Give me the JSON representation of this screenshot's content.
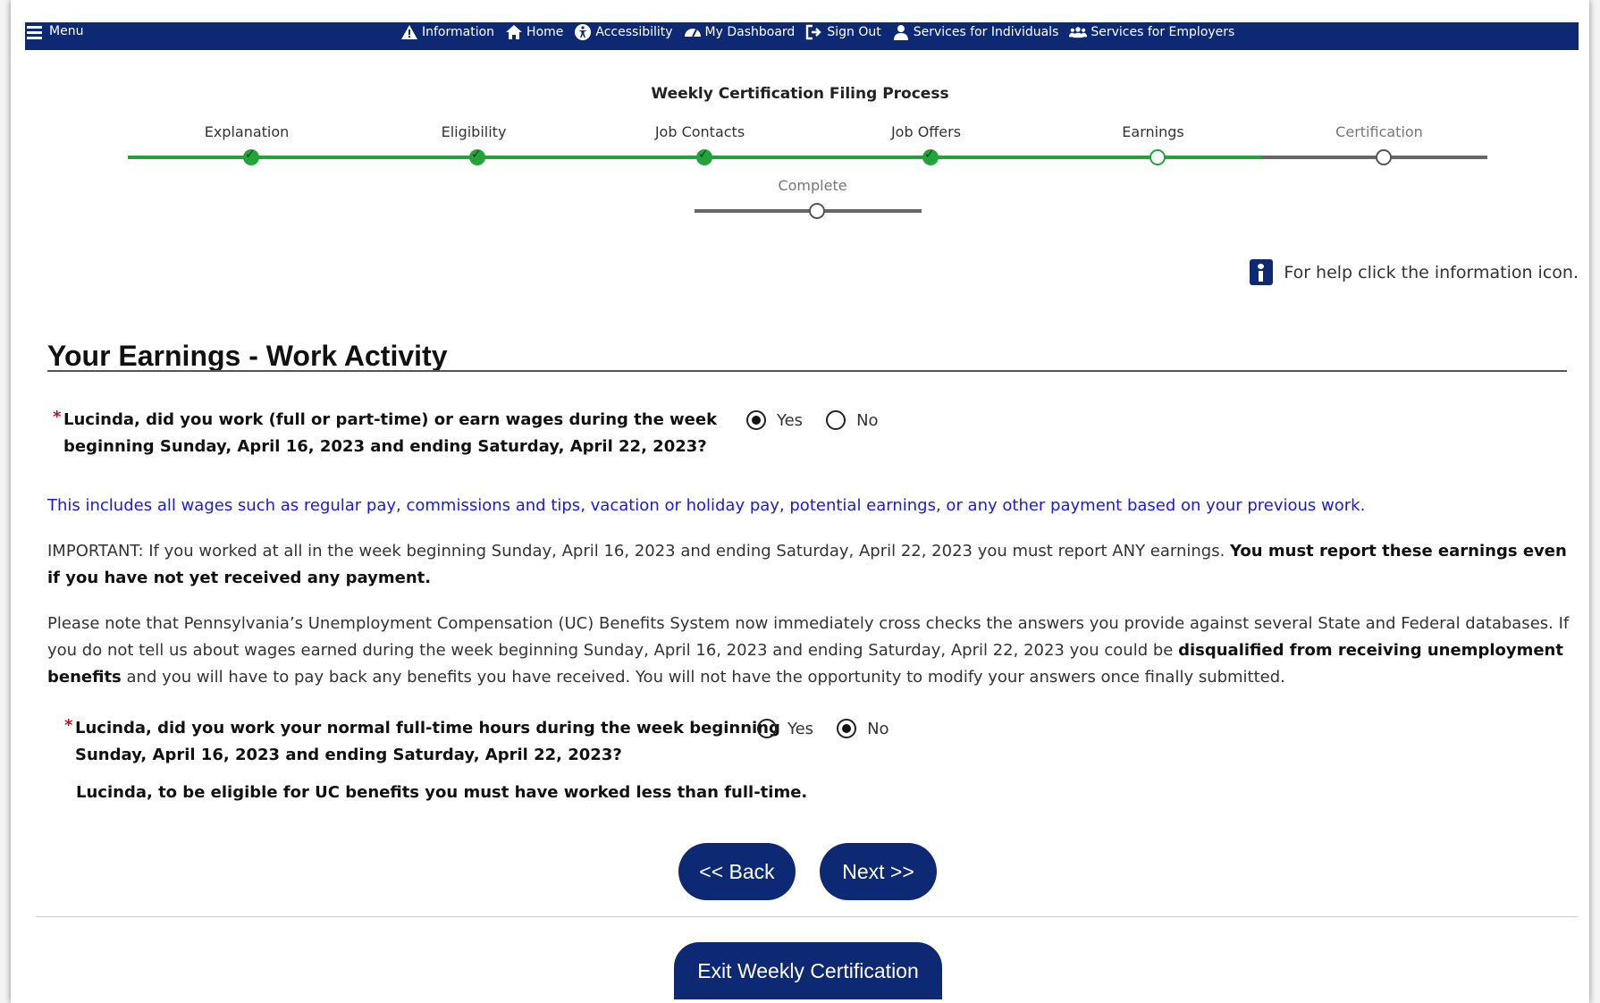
{
  "nav": {
    "menu_label": "Menu",
    "links": [
      {
        "label": "Information",
        "icon": "warning-icon"
      },
      {
        "label": "Home",
        "icon": "home-icon"
      },
      {
        "label": "Accessibility",
        "icon": "accessibility-icon"
      },
      {
        "label": "My Dashboard",
        "icon": "dashboard-icon"
      },
      {
        "label": "Sign Out",
        "icon": "sign-out-icon"
      },
      {
        "label": "Services for Individuals",
        "icon": "person-icon"
      },
      {
        "label": "Services for Employers",
        "icon": "group-icon"
      }
    ]
  },
  "tracker": {
    "title": "Weekly Certification Filing Process",
    "steps": [
      {
        "label": "Explanation",
        "status": "done"
      },
      {
        "label": "Eligibility",
        "status": "done"
      },
      {
        "label": "Job Contacts",
        "status": "done"
      },
      {
        "label": "Job Offers",
        "status": "done"
      },
      {
        "label": "Earnings",
        "status": "current"
      },
      {
        "label": "Certification",
        "status": "future"
      },
      {
        "label": "Complete",
        "status": "future"
      }
    ]
  },
  "help": {
    "text": "For help click the information icon."
  },
  "section": {
    "title": "Your Earnings - Work Activity"
  },
  "q1": {
    "required_mark": "*",
    "line1": "Lucinda, did you work (full or part-time) or earn wages during the week",
    "line2": "beginning Sunday, April 16, 2023 and ending Saturday, April 22, 2023?",
    "options": [
      "Yes",
      "No"
    ],
    "selected": "Yes"
  },
  "info_text": "This includes all wages such as regular pay, commissions and tips, vacation or holiday pay, potential earnings, or any other payment based on your previous work.",
  "important": {
    "plain": "IMPORTANT: If you worked at all in the week beginning Sunday, April 16, 2023 and ending Saturday, April 22, 2023 you must report ANY earnings. ",
    "bold": "You must report these earnings even if you have not yet received any payment."
  },
  "notice": {
    "part1": "Please note that Pennsylvania’s Unemployment Compensation (UC) Benefits System now immediately cross checks the answers you provide against several State and Federal databases. If you do not tell us about wages earned during the week beginning Sunday, April 16, 2023 and ending Saturday, April 22, 2023 you could be ",
    "bold": "disqualified from receiving unemployment benefits",
    "part2": " and you will have to pay back any benefits you have received. You will not have the opportunity to modify your answers once finally submitted."
  },
  "q2": {
    "required_mark": "*",
    "line1": "Lucinda, did you work your normal full-time hours during the week beginning",
    "line2": "Sunday, April 16, 2023 and ending Saturday, April 22, 2023?",
    "options": [
      "Yes",
      "No"
    ],
    "selected": "No"
  },
  "eligibility_note": "Lucinda, to be eligible for UC benefits you must have worked less than full-time.",
  "buttons": {
    "back": "<< Back",
    "next": "Next >>",
    "exit": "Exit Weekly Certification"
  },
  "colors": {
    "brand_navy": "#0d2973",
    "progress_green": "#22a43a",
    "info_blue": "#1a1ae0",
    "required_red": "#c0141a"
  }
}
